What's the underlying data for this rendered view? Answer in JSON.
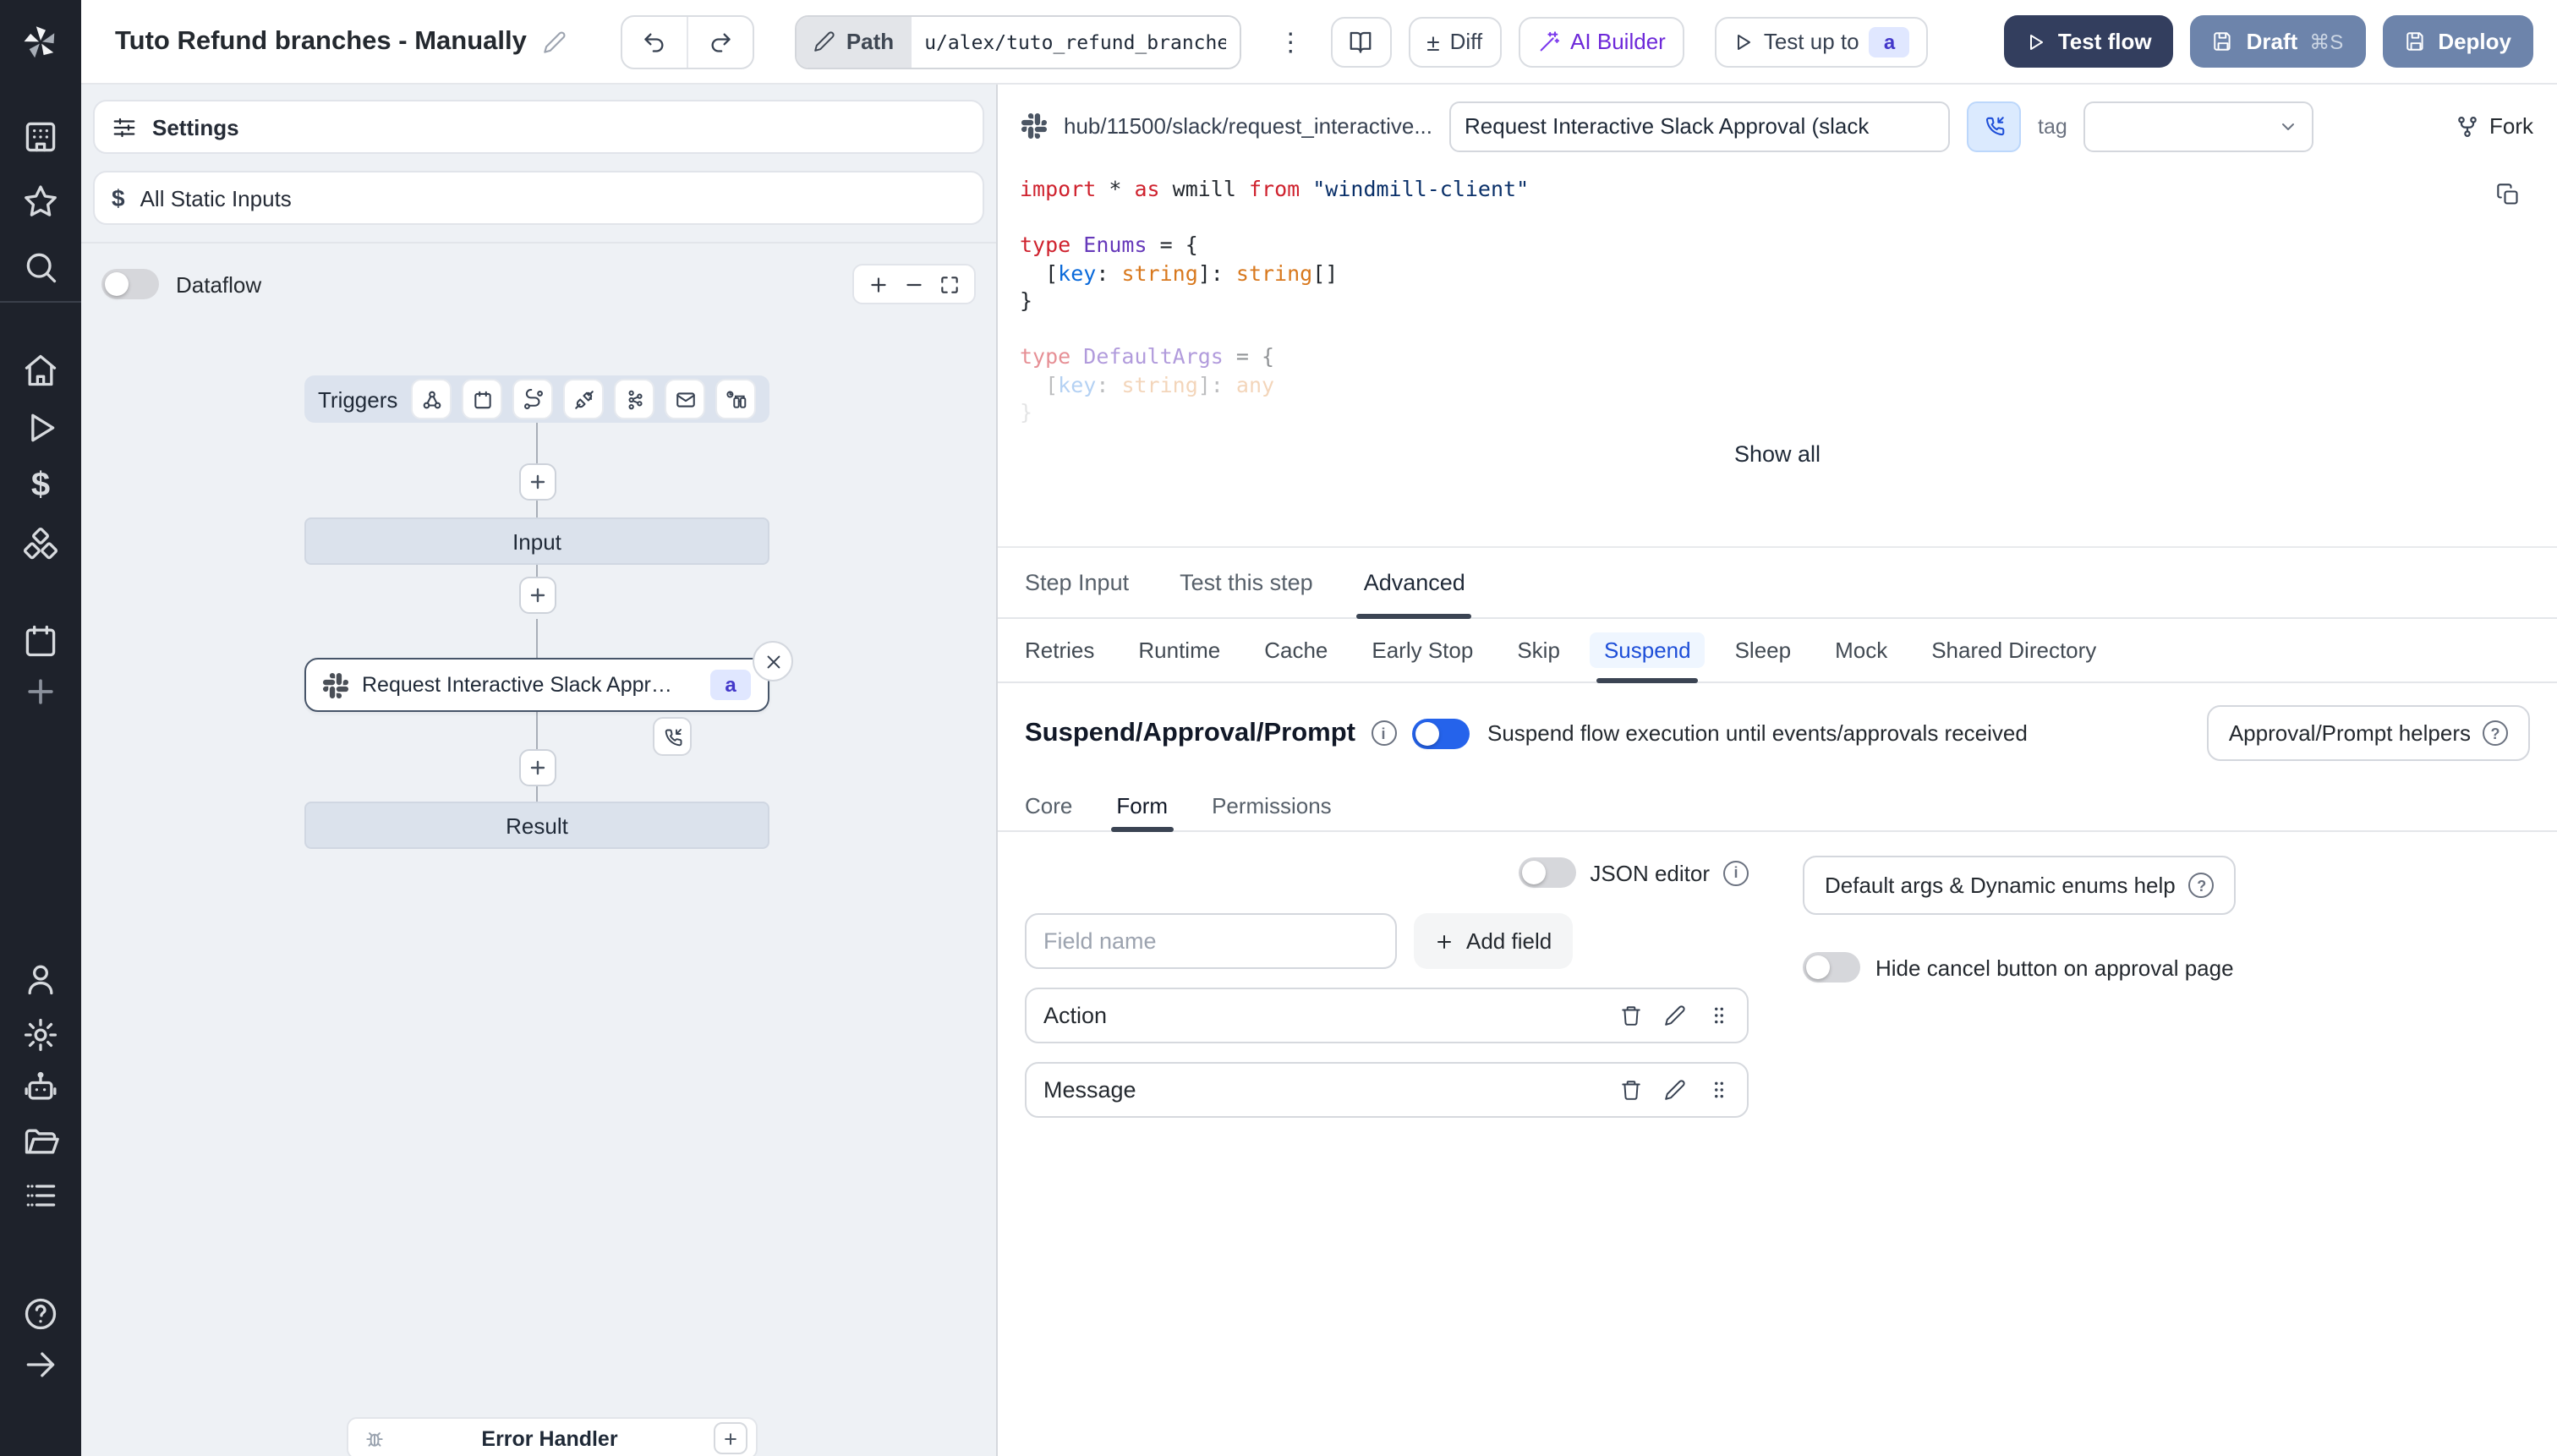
{
  "topbar": {
    "title": "Tuto Refund branches - Manually",
    "path_label": "Path",
    "path_value": "u/alex/tuto_refund_branches__",
    "diff_label": "Diff",
    "plusminus": "±",
    "ai_builder_label": "AI Builder",
    "test_up_to_label": "Test up to",
    "test_up_to_badge": "a",
    "test_flow_label": "Test flow",
    "draft_label": "Draft",
    "draft_shortcut": "⌘S",
    "deploy_label": "Deploy"
  },
  "sidebar": {
    "icon_names": [
      "workspace",
      "favorites",
      "search",
      "home",
      "runs",
      "variables",
      "resources",
      "schedules",
      "add",
      "user",
      "settings",
      "ai",
      "folders",
      "logs",
      "help",
      "expand"
    ]
  },
  "left_panel": {
    "settings_label": "Settings",
    "static_inputs_label": "All Static Inputs",
    "dataflow_label": "Dataflow",
    "graph": {
      "triggers_label": "Triggers",
      "trigger_icon_names": [
        "webhook",
        "schedule",
        "route",
        "websocket",
        "kafka",
        "email",
        "poll"
      ],
      "input_label": "Input",
      "step_title": "Request Interactive Slack Approval (...",
      "step_badge": "a",
      "result_label": "Result",
      "error_handler_label": "Error Handler"
    }
  },
  "right_panel": {
    "hub_path": "hub/11500/slack/request_interactive...",
    "script_name": "Request Interactive Slack Approval (slack",
    "tag_label": "tag",
    "fork_label": "Fork",
    "show_all_label": "Show all",
    "tabs": [
      "Step Input",
      "Test this step",
      "Advanced"
    ],
    "active_tab": "Advanced",
    "subtabs": [
      "Retries",
      "Runtime",
      "Cache",
      "Early Stop",
      "Skip",
      "Suspend",
      "Sleep",
      "Mock",
      "Shared Directory"
    ],
    "active_subtab": "Suspend",
    "code": {
      "lines": [
        {
          "fade": 1,
          "tokens": [
            {
              "t": "import",
              "c": "kw"
            },
            {
              "t": " * ",
              "c": "pl"
            },
            {
              "t": "as",
              "c": "kw"
            },
            {
              "t": " wmill ",
              "c": "pl"
            },
            {
              "t": "from",
              "c": "kw"
            },
            {
              "t": " ",
              "c": "pl"
            },
            {
              "t": "\"windmill-client\"",
              "c": "str"
            }
          ]
        },
        {
          "fade": 1,
          "tokens": []
        },
        {
          "fade": 1,
          "tokens": [
            {
              "t": "type",
              "c": "kw"
            },
            {
              "t": " ",
              "c": "pl"
            },
            {
              "t": "Enums",
              "c": "typ"
            },
            {
              "t": " = {",
              "c": "pl"
            }
          ]
        },
        {
          "fade": 1,
          "tokens": [
            {
              "t": "  [",
              "c": "pl"
            },
            {
              "t": "key",
              "c": "key"
            },
            {
              "t": ": ",
              "c": "pl"
            },
            {
              "t": "string",
              "c": "orn"
            },
            {
              "t": "]: ",
              "c": "pl"
            },
            {
              "t": "string",
              "c": "orn"
            },
            {
              "t": "[]",
              "c": "pl"
            }
          ]
        },
        {
          "fade": 1,
          "tokens": [
            {
              "t": "}",
              "c": "pl"
            }
          ]
        },
        {
          "fade": 1,
          "tokens": []
        },
        {
          "fade": 0.5,
          "tokens": [
            {
              "t": "type",
              "c": "kw"
            },
            {
              "t": " ",
              "c": "pl"
            },
            {
              "t": "DefaultArgs",
              "c": "typ"
            },
            {
              "t": " = {",
              "c": "pl"
            }
          ]
        },
        {
          "fade": 0.3,
          "tokens": [
            {
              "t": "  [",
              "c": "pl"
            },
            {
              "t": "key",
              "c": "key"
            },
            {
              "t": ": ",
              "c": "pl"
            },
            {
              "t": "string",
              "c": "orn"
            },
            {
              "t": "]: ",
              "c": "pl"
            },
            {
              "t": "any",
              "c": "orn"
            }
          ]
        },
        {
          "fade": 0.12,
          "tokens": [
            {
              "t": "}",
              "c": "pl"
            }
          ]
        }
      ]
    },
    "suspend": {
      "heading": "Suspend/Approval/Prompt",
      "toggle_on": true,
      "description": "Suspend flow execution until events/approvals received",
      "helpers_label": "Approval/Prompt helpers",
      "inner_tabs": [
        "Core",
        "Form",
        "Permissions"
      ],
      "active_inner_tab": "Form",
      "json_editor_label": "JSON editor",
      "field_placeholder": "Field name",
      "add_field_label": "Add field",
      "fields": [
        "Action",
        "Message"
      ],
      "default_args_label": "Default args & Dynamic enums help",
      "hide_cancel_label": "Hide cancel button on approval page"
    }
  },
  "colors": {
    "accent": "#2563eb",
    "dark_button": "#333e5e",
    "slate_button": "#6d84ab",
    "ai_purple": "#6d28d9",
    "badge_bg": "#e0e7ff",
    "badge_text": "#4338ca",
    "sidebar_bg": "#1e222b",
    "graph_bg": "#eef1f5"
  }
}
